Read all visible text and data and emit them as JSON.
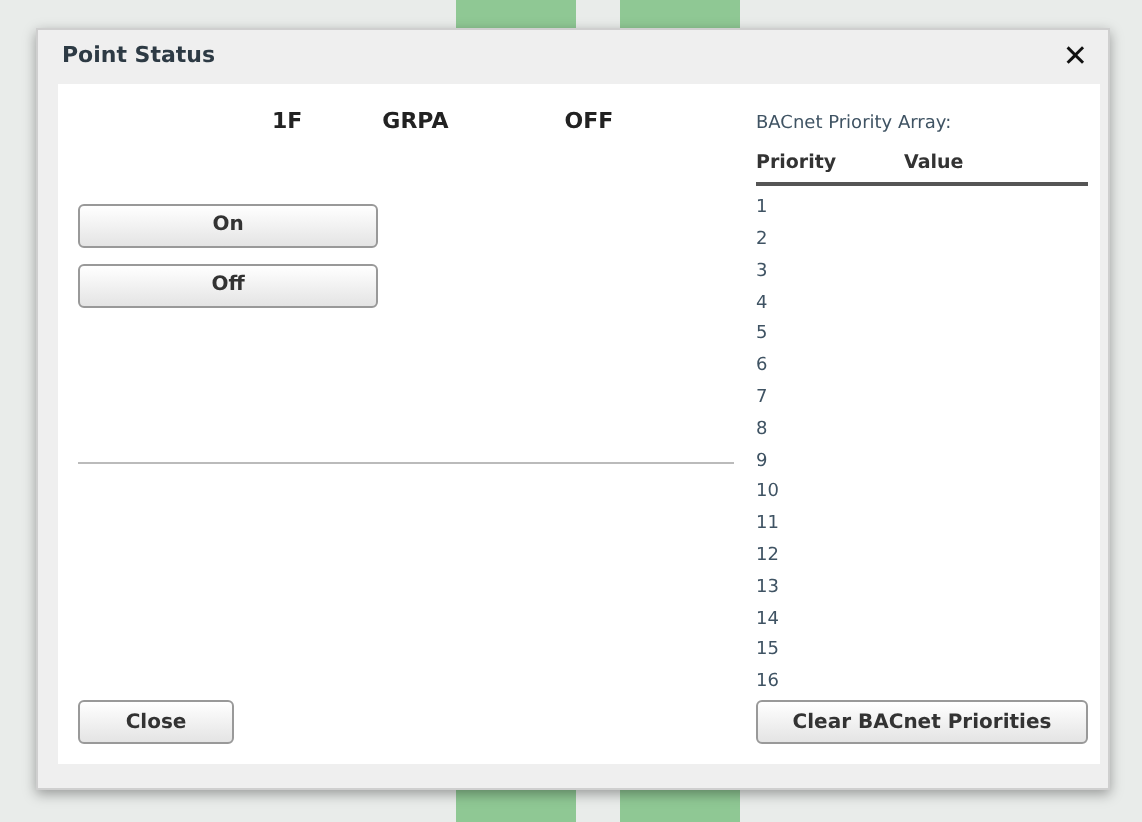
{
  "dialog": {
    "title": "Point Status",
    "close_icon": "✕"
  },
  "point": {
    "floor": "1F",
    "group": "GRPA",
    "state": "OFF"
  },
  "commands": [
    "On",
    "Off"
  ],
  "priority_array": {
    "title": "BACnet Priority Array:",
    "columns": [
      "Priority",
      "Value"
    ],
    "rows": [
      "1",
      "2",
      "3",
      "4",
      "5",
      "6",
      "7",
      "8",
      "9",
      "10",
      "11",
      "12",
      "13",
      "14",
      "15",
      "16"
    ]
  },
  "buttons": {
    "close": "Close",
    "clear": "Clear BACnet Priorities"
  }
}
